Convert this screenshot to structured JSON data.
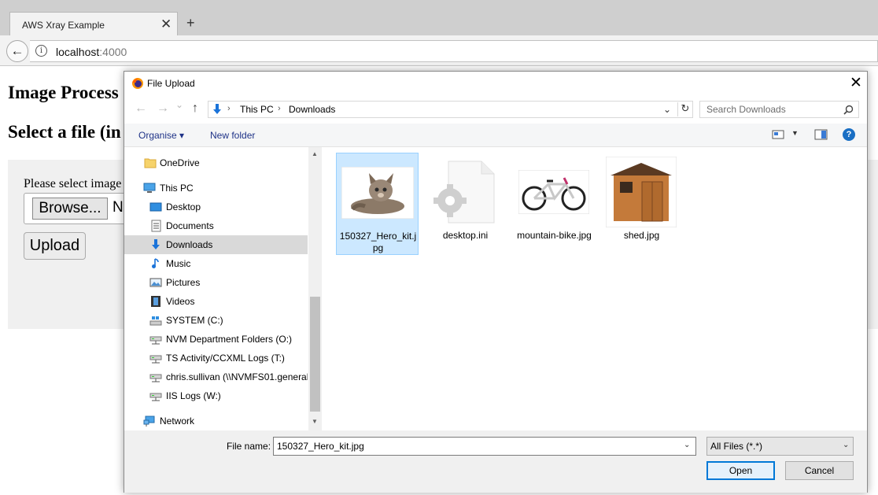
{
  "browser": {
    "tab_title": "AWS Xray Example",
    "tab_close": "✕",
    "new_tab": "+",
    "back": "←",
    "info": "i",
    "url_host": "localhost",
    "url_port": ":4000"
  },
  "page": {
    "title": "Image Process",
    "select_heading": "Select a file (in",
    "file_label": "Please select image",
    "browse_label": "Browse...",
    "no_file": "N",
    "upload_label": "Upload"
  },
  "dialog": {
    "title": "File Upload",
    "close": "✕",
    "nav": {
      "back": "←",
      "forward": "→",
      "recent": "⌄",
      "up": "↑"
    },
    "address": {
      "sep": "›",
      "crumb_pc": "This PC",
      "crumb_downloads": "Downloads",
      "dropdown": "⌄",
      "refresh": "↻"
    },
    "search_placeholder": "Search Downloads",
    "toolbar": {
      "organise": "Organise ▾",
      "new_folder": "New folder",
      "view_dropdown": "▼",
      "help": "?"
    },
    "nav_items": [
      {
        "label": "OneDrive",
        "icon": "folder-icon"
      },
      {
        "label": "This PC",
        "icon": "computer-icon"
      },
      {
        "label": "Desktop",
        "icon": "desktop-icon"
      },
      {
        "label": "Documents",
        "icon": "documents-icon"
      },
      {
        "label": "Downloads",
        "icon": "downloads-icon"
      },
      {
        "label": "Music",
        "icon": "music-icon"
      },
      {
        "label": "Pictures",
        "icon": "pictures-icon"
      },
      {
        "label": "Videos",
        "icon": "videos-icon"
      },
      {
        "label": "SYSTEM (C:)",
        "icon": "drive-icon"
      },
      {
        "label": "NVM Department Folders (O:)",
        "icon": "network-drive-icon"
      },
      {
        "label": "TS Activity/CCXML Logs (T:)",
        "icon": "network-drive-icon"
      },
      {
        "label": "chris.sullivan (\\\\NVMFS01.general.",
        "icon": "network-drive-icon"
      },
      {
        "label": "IIS Logs (W:)",
        "icon": "network-drive-icon"
      },
      {
        "label": "Network",
        "icon": "network-icon"
      }
    ],
    "scroll": {
      "up": "▲",
      "down": "▼"
    },
    "files": [
      {
        "name": "150327_Hero_kit.jpg",
        "icon": "kitten-thumbnail"
      },
      {
        "name": "desktop.ini",
        "icon": "settings-file-icon"
      },
      {
        "name": "mountain-bike.jpg",
        "icon": "bike-thumbnail"
      },
      {
        "name": "shed.jpg",
        "icon": "shed-thumbnail"
      }
    ],
    "file_name_label": "File name:",
    "file_name_value": "150327_Hero_kit.jpg",
    "file_name_dropdown": "⌄",
    "filter_value": "All Files (*.*)",
    "filter_dropdown": "⌄",
    "open_label": "Open",
    "cancel_label": "Cancel"
  }
}
